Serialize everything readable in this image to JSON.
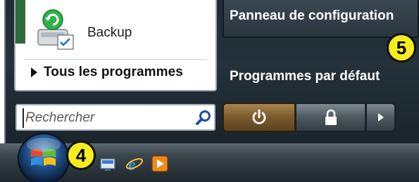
{
  "left_pane": {
    "pinned_item_label": "Backup",
    "all_programs_label": "Tous les programmes"
  },
  "search": {
    "placeholder": "Rechercher"
  },
  "right_pane": {
    "control_panel_label": "Panneau de configuration",
    "default_programs_label": "Programmes par défaut"
  },
  "power_controls": {
    "power_icon": "power-icon",
    "lock_icon": "lock-icon",
    "more_icon": "chevron-right-icon"
  },
  "taskbar": {
    "start_icon": "windows-orb-icon",
    "quick_launch": [
      "show-desktop-icon",
      "internet-explorer-icon",
      "media-player-icon"
    ]
  },
  "callouts": {
    "taskbar_marker": "4",
    "menu_marker": "5"
  },
  "colors": {
    "callout_fill": "#f6ee1c",
    "power_button": "#7a5a2c",
    "menu_dark": "#24313a"
  }
}
